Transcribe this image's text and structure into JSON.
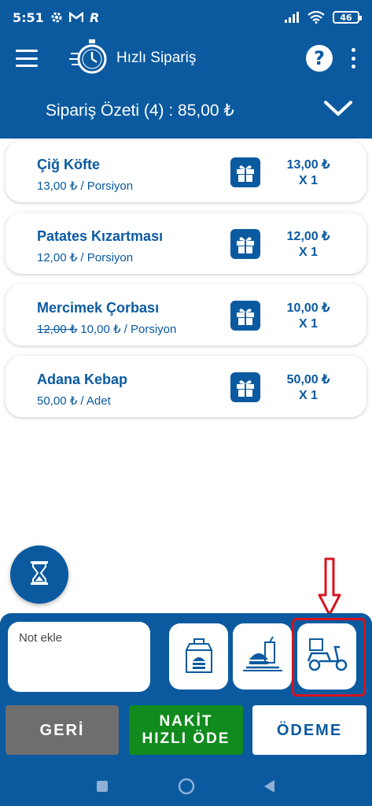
{
  "status_bar": {
    "time": "5:51",
    "icons": [
      "settings-icon",
      "gmail-icon",
      "r-app-icon"
    ],
    "battery": "46",
    "right_icons": [
      "signal-icon",
      "wifi-icon",
      "battery-icon"
    ]
  },
  "app_bar": {
    "title": "Hızlı Sipariş",
    "help_label": "?",
    "icons": [
      "menu-icon",
      "stopwatch-icon",
      "help-icon",
      "more-vert-icon"
    ]
  },
  "summary": {
    "title": "Sipariş Özeti (4) : 85,00 ₺",
    "icon": "chevron-down-icon"
  },
  "items": [
    {
      "name": "Çiğ Köfte",
      "old_price": "",
      "price": "13,00 ₺ / Porsiyon",
      "total": "13,00 ₺",
      "qty": "X 1"
    },
    {
      "name": "Patates Kızartması",
      "old_price": "",
      "price": "12,00 ₺ / Porsiyon",
      "total": "12,00 ₺",
      "qty": "X 1"
    },
    {
      "name": "Mercimek Çorbası",
      "old_price": "12,00 ₺",
      "price": "10,00 ₺ / Porsiyon",
      "total": "10,00 ₺",
      "qty": "X 1"
    },
    {
      "name": "Adana Kebap",
      "old_price": "",
      "price": "50,00 ₺ / Adet",
      "total": "50,00 ₺",
      "qty": "X 1"
    }
  ],
  "bottom": {
    "note_placeholder": "Not ekle",
    "order_types": [
      "takeaway-bag-icon",
      "dine-in-tray-icon",
      "delivery-scooter-icon"
    ],
    "back_label": "GERİ",
    "cash_line1": "NAKİT",
    "cash_line2": "HIZLI ÖDE",
    "pay_label": "ÖDEME"
  },
  "colors": {
    "primary": "#0b5aa0",
    "cash": "#118a1e",
    "back": "#6e6e6e",
    "annotation": "#d6141f"
  }
}
